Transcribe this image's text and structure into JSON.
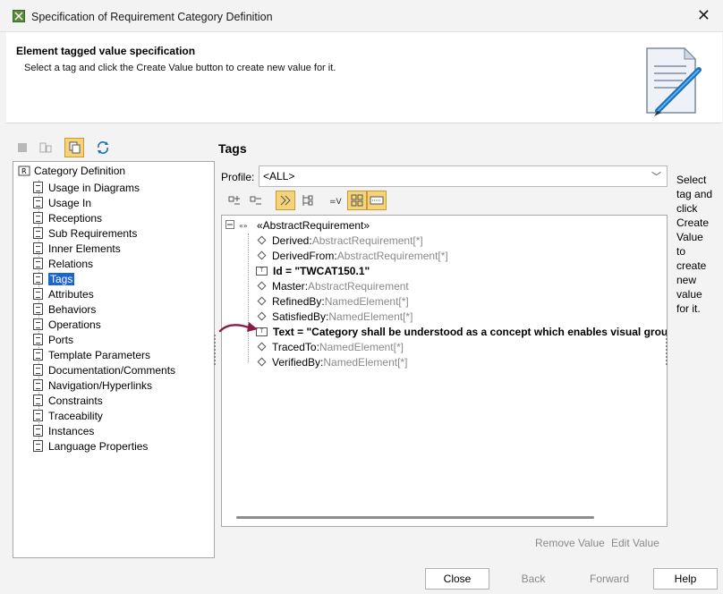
{
  "window": {
    "title": "Specification of Requirement Category Definition",
    "close_glyph": "✕"
  },
  "header": {
    "title": "Element tagged value specification",
    "description": "Select a tag and click the Create Value button to create new value for it."
  },
  "tree": {
    "root_label": "Category Definition",
    "items": [
      {
        "label": "Usage in Diagrams"
      },
      {
        "label": "Usage In"
      },
      {
        "label": "Receptions"
      },
      {
        "label": "Sub Requirements"
      },
      {
        "label": "Inner Elements"
      },
      {
        "label": "Relations"
      },
      {
        "label": "Tags",
        "selected": true
      },
      {
        "label": "Attributes"
      },
      {
        "label": "Behaviors"
      },
      {
        "label": "Operations"
      },
      {
        "label": "Ports"
      },
      {
        "label": "Template Parameters"
      },
      {
        "label": "Documentation/Comments"
      },
      {
        "label": "Navigation/Hyperlinks"
      },
      {
        "label": "Constraints"
      },
      {
        "label": "Traceability"
      },
      {
        "label": "Instances"
      },
      {
        "label": "Language Properties"
      }
    ]
  },
  "tags": {
    "title": "Tags",
    "profile_label": "Profile:",
    "profile_value": "<ALL>",
    "stereotype": "«AbstractRequirement»",
    "rows": [
      {
        "name": "Derived",
        "sep": " : ",
        "type": "AbstractRequirement[*]"
      },
      {
        "name": "DerivedFrom",
        "sep": " : ",
        "type": "AbstractRequirement[*]"
      },
      {
        "name": "Id = \"TWCAT150.1\"",
        "sep": "",
        "type": ""
      },
      {
        "name": "Master",
        "sep": " : ",
        "type": "AbstractRequirement"
      },
      {
        "name": "RefinedBy",
        "sep": " : ",
        "type": "NamedElement[*]"
      },
      {
        "name": "SatisfiedBy",
        "sep": " : ",
        "type": "NamedElement[*]"
      },
      {
        "name": "Text = \"Category shall be understood as a concept which enables visual grouping",
        "sep": "",
        "type": ""
      },
      {
        "name": "TracedTo",
        "sep": " : ",
        "type": "NamedElement[*]"
      },
      {
        "name": "VerifiedBy",
        "sep": " : ",
        "type": "NamedElement[*]"
      }
    ],
    "help_text": "Select tag and click Create Value to create new value for it.",
    "remove_value": "Remove Value",
    "edit_value": "Edit Value"
  },
  "buttons": {
    "close": "Close",
    "back": "Back",
    "forward": "Forward",
    "help": "Help"
  },
  "colors": {
    "selection": "#1a66cc",
    "toggle_active": "#f4d37a",
    "arrow": "#8b1a4a"
  }
}
